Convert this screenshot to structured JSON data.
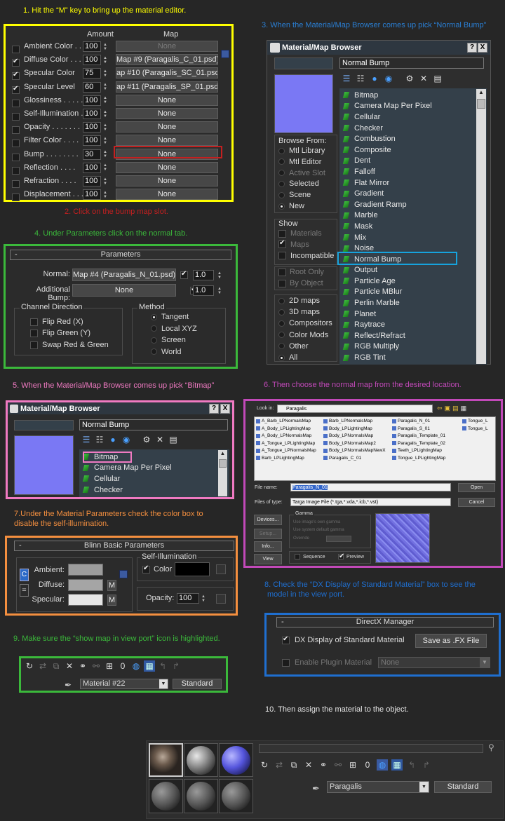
{
  "colors": {
    "yellow": "#ffff00",
    "green": "#3bb93b",
    "pink": "#f07ac2",
    "purple": "#c249b9",
    "orange": "#f48f3f",
    "blue": "#1f6fd0",
    "red": "#c42020",
    "cyan": "#16a3dd"
  },
  "steps": {
    "s1": "1. Hit the “M” key to bring up the material editor.",
    "s2": "2. Click on the bump map slot.",
    "s3": "3. When the Material/Map Browser comes up pick “Normal Bump”",
    "s4": "4. Under Parameters click on the normal tab.",
    "s5": "5. When the Material/Map Browser comes up pick “Bitmap”",
    "s6": "6. Then choose the normal map from the desired location.",
    "s7a": "7.Under the Material Parameters check the color box to",
    "s7b": "disable the self-illumination.",
    "s8a": "8. Check the “DX Display of Standard Material” box to see the",
    "s8b": "model in the view port.",
    "s9": "9. Make sure the “show map in view port” icon is highlighted.",
    "s10": "10. Then assign the material to the object."
  },
  "maps_panel": {
    "head_amount": "Amount",
    "head_map": "Map",
    "rows": [
      {
        "label": "Ambient Color . .",
        "checked": false,
        "amount": "100",
        "map": "None",
        "dim": true
      },
      {
        "label": "Diffuse Color . . .",
        "checked": true,
        "amount": "100",
        "map": "Map #9 (Paragalis_C_01.psd)",
        "dim": false
      },
      {
        "label": "Specular Color",
        "checked": true,
        "amount": "75",
        "map": "ap #10 (Paragalis_SC_01.psd)",
        "dim": false
      },
      {
        "label": "Specular Level",
        "checked": true,
        "amount": "60",
        "map": "ap #11 (Paragalis_SP_01.psd)",
        "dim": false
      },
      {
        "label": "Glossiness . . . . .",
        "checked": false,
        "amount": "100",
        "map": "None",
        "dim": false
      },
      {
        "label": "Self-Illumination .",
        "checked": false,
        "amount": "100",
        "map": "None",
        "dim": false
      },
      {
        "label": "Opacity . . . . . . . .",
        "checked": false,
        "amount": "100",
        "map": "None",
        "dim": false
      },
      {
        "label": "Filter Color . . . .",
        "checked": false,
        "amount": "100",
        "map": "None",
        "dim": false
      },
      {
        "label": "Bump . . . . . . . .",
        "checked": false,
        "amount": "30",
        "map": "None",
        "dim": false
      },
      {
        "label": "Reflection . . . .",
        "checked": false,
        "amount": "100",
        "map": "None",
        "dim": false
      },
      {
        "label": "Refraction . . . .",
        "checked": false,
        "amount": "100",
        "map": "None",
        "dim": false
      },
      {
        "label": "Displacement . . .",
        "checked": false,
        "amount": "100",
        "map": "None",
        "dim": false
      }
    ]
  },
  "browser1": {
    "title": "Material/Map Browser",
    "help": "?",
    "close": "X",
    "search": "Normal Bump",
    "browse_from": "Browse From:",
    "browse_options": [
      {
        "label": "Mtl Library",
        "on": false,
        "dim": false
      },
      {
        "label": "Mtl Editor",
        "on": false,
        "dim": false
      },
      {
        "label": "Active Slot",
        "on": false,
        "dim": true
      },
      {
        "label": "Selected",
        "on": false,
        "dim": false
      },
      {
        "label": "Scene",
        "on": false,
        "dim": false
      },
      {
        "label": "New",
        "on": true,
        "dim": false
      }
    ],
    "show": "Show",
    "show_options": [
      {
        "label": "Materials",
        "on": false,
        "dim": true
      },
      {
        "label": "Maps",
        "on": true,
        "dim": true
      },
      {
        "label": "Incompatible",
        "on": false,
        "dim": false
      }
    ],
    "root_only": "Root Only",
    "by_object": "By Object",
    "cat_options": [
      {
        "label": "2D maps",
        "on": false
      },
      {
        "label": "3D maps",
        "on": false
      },
      {
        "label": "Compositors",
        "on": false
      },
      {
        "label": "Color Mods",
        "on": false
      },
      {
        "label": "Other",
        "on": false
      },
      {
        "label": "All",
        "on": true
      }
    ],
    "items": [
      "Bitmap",
      "Camera Map Per Pixel",
      "Cellular",
      "Checker",
      "Combustion",
      "Composite",
      "Dent",
      "Falloff",
      "Flat Mirror",
      "Gradient",
      "Gradient Ramp",
      "Marble",
      "Mask",
      "Mix",
      "Noise",
      "Normal Bump",
      "Output",
      "Particle Age",
      "Particle MBlur",
      "Perlin Marble",
      "Planet",
      "Raytrace",
      "Reflect/Refract",
      "RGB Multiply",
      "RGB Tint"
    ],
    "selected": "Normal Bump"
  },
  "params": {
    "collapse": "-",
    "title": "Parameters",
    "normal_label": "Normal:",
    "normal_map": "Map #4 (Paragalis_N_01.psd)",
    "normal_amt": "1.0",
    "bump_label": "Additional Bump:",
    "bump_map": "None",
    "bump_amt": "1.0",
    "channel_title": "Channel Direction",
    "flip_red": "Flip Red (X)",
    "flip_green": "Flip Green (Y)",
    "swap": "Swap Red & Green",
    "method_title": "Method",
    "methods": [
      {
        "label": "Tangent",
        "on": true
      },
      {
        "label": "Local XYZ",
        "on": false
      },
      {
        "label": "Screen",
        "on": false
      },
      {
        "label": "World",
        "on": false
      }
    ]
  },
  "browser2": {
    "title": "Material/Map Browser",
    "help": "?",
    "close": "X",
    "search": "Normal Bump",
    "items": [
      "Bitmap",
      "Camera Map Per Pixel",
      "Cellular",
      "Checker"
    ]
  },
  "filedlg": {
    "look_in_label": "Look in:",
    "look_in": "Paragalis",
    "files": [
      [
        "A_Barb_LPNormalsMap",
        "Barb_LPNormalsMap",
        "Paragalis_N_01",
        "Tongue_L"
      ],
      [
        "A_Body_LPLightingMap",
        "Body_LPLightingMap",
        "Paragalis_S_01",
        "Tongue_L"
      ],
      [
        "A_Body_LPNormalsMap",
        "Body_LPNormalsMap",
        "Paragalis_Template_01",
        ""
      ],
      [
        "A_Tongue_LPLightingMap",
        "Body_LPNormalsMap2",
        "Paragalis_Template_02",
        ""
      ],
      [
        "A_Tongue_LPNormalsMap",
        "Body_LPNormalsMapNewX",
        "Teeth_LPLightingMap",
        ""
      ],
      [
        "Barb_LPLightingMap",
        "Paragalis_C_01",
        "Tongue_LPLightingMap",
        ""
      ]
    ],
    "file_name_label": "File name:",
    "file_name": "Paragalis_N_01",
    "open": "Open",
    "type_label": "Files of type:",
    "type": "Targa Image File (*.tga,*.vda,*.icb,*.vst)",
    "cancel": "Cancel",
    "devices": "Devices...",
    "setup": "Setup...",
    "info": "Info...",
    "view": "View",
    "gamma": "Gamma",
    "g1": "Use image's own gamma",
    "g2": "Use system default gamma",
    "g3": "Override",
    "sequence": "Sequence",
    "preview": "Preview"
  },
  "blinn": {
    "collapse": "-",
    "title": "Blinn Basic Parameters",
    "c_btn": "C",
    "selfillum": "Self-Illumination",
    "color": "Color",
    "ambient": "Ambient:",
    "diffuse": "Diffuse:",
    "specular": "Specular:",
    "m": "M",
    "opacity": "Opacity:",
    "opacity_val": "100",
    "ambient_col": "#9c9c9c",
    "diffuse_col": "#a5a5a5",
    "specular_col": "#e6e6e6",
    "selfillum_col": "#000000"
  },
  "dx": {
    "collapse": "-",
    "title": "DirectX Manager",
    "dx_display": "DX Display of Standard Material",
    "save_fx": "Save as .FX File",
    "plugin": "Enable Plugin Material",
    "plugin_val": "None"
  },
  "toolbar9": {
    "material": "Material #22",
    "type": "Standard"
  },
  "toolbar10": {
    "material": "Paragalis",
    "type": "Standard"
  }
}
